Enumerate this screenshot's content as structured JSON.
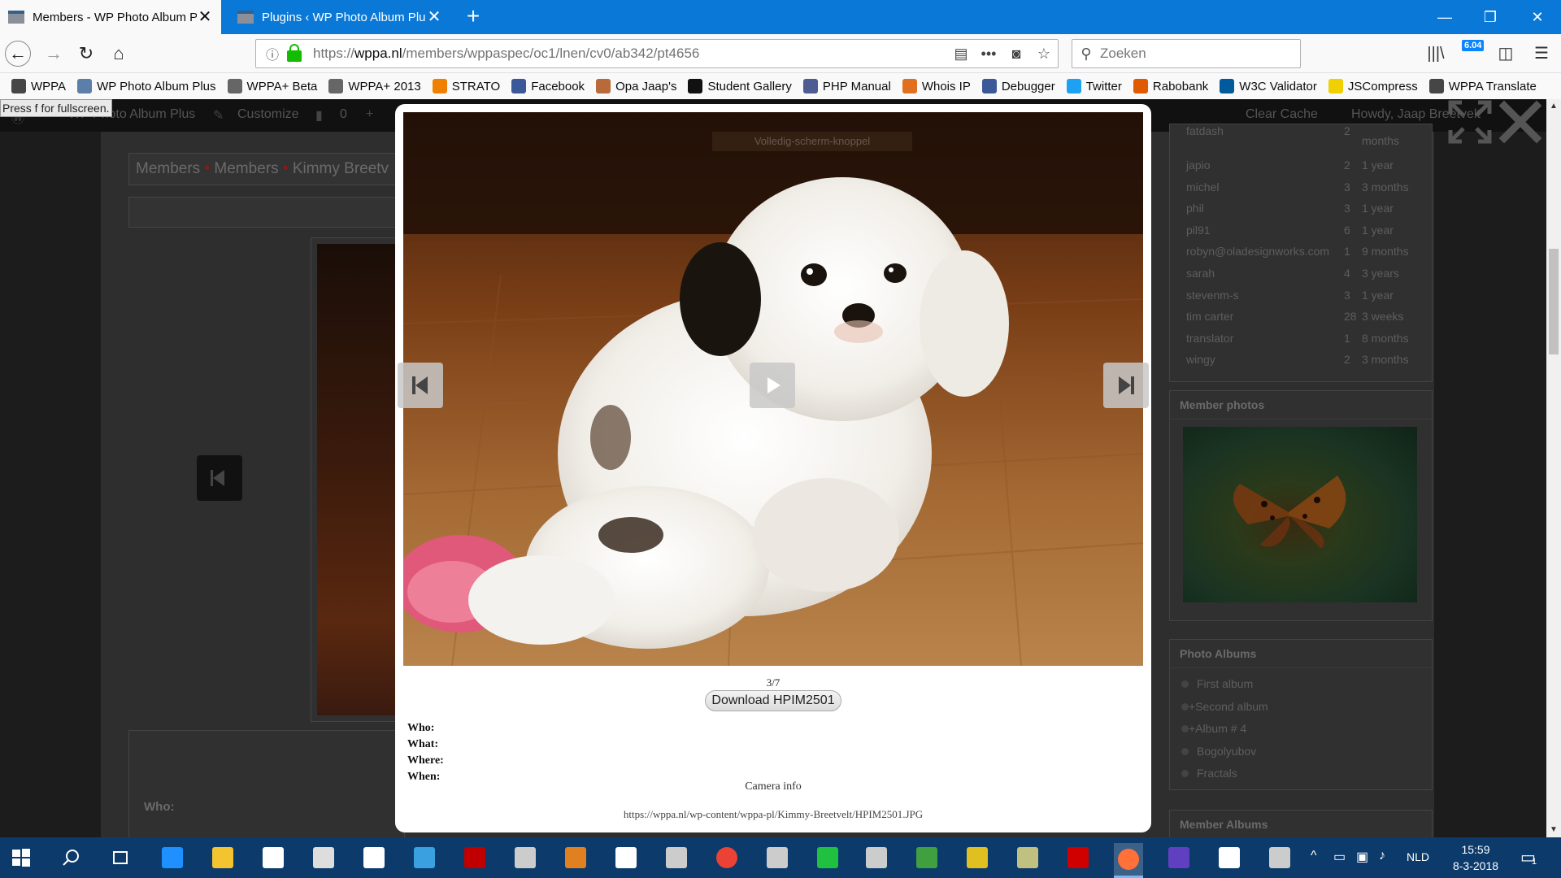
{
  "browser": {
    "tabs": [
      {
        "title": "Members - WP Photo Album Pl",
        "close": "✕",
        "active": true
      },
      {
        "title": "Plugins ‹ WP Photo Album Plus",
        "close": "✕",
        "active": false
      }
    ],
    "new_tab": "+",
    "window_controls": {
      "minimize": "—",
      "restore": "❐",
      "close": "✕"
    },
    "url": {
      "scheme": "https://",
      "domain": "wppa.nl",
      "path": "/members/wppaspec/oc1/lnen/cv0/ab342/pt4656"
    },
    "search_placeholder": "Zoeken",
    "extension_badge": "6.04",
    "bookmarks": [
      {
        "label": "WPPA",
        "icon": "wordpress-icon",
        "color": "#464646"
      },
      {
        "label": "WP Photo Album Plus",
        "icon": "wppa-icon",
        "color": "#5b7fa8"
      },
      {
        "label": "WPPA+ Beta",
        "icon": "globe-icon",
        "color": "#666666"
      },
      {
        "label": "WPPA+ 2013",
        "icon": "globe-icon",
        "color": "#666666"
      },
      {
        "label": "STRATO",
        "icon": "strato-icon",
        "color": "#f08000"
      },
      {
        "label": "Facebook",
        "icon": "facebook-icon",
        "color": "#3b5998"
      },
      {
        "label": "Opa Jaap's",
        "icon": "photo-icon",
        "color": "#b86a3a"
      },
      {
        "label": "Student Gallery",
        "icon": "gallery-icon",
        "color": "#111111"
      },
      {
        "label": "PHP Manual",
        "icon": "php-icon",
        "color": "#4f5b93"
      },
      {
        "label": "Whois IP",
        "icon": "whois-icon",
        "color": "#e07020"
      },
      {
        "label": "Debugger",
        "icon": "facebook-icon",
        "color": "#3b5998"
      },
      {
        "label": "Twitter",
        "icon": "twitter-icon",
        "color": "#1da1f2"
      },
      {
        "label": "Rabobank",
        "icon": "rabobank-icon",
        "color": "#e05a00"
      },
      {
        "label": "W3C Validator",
        "icon": "w3c-icon",
        "color": "#005a9c"
      },
      {
        "label": "JSCompress",
        "icon": "js-icon",
        "color": "#f0d000"
      },
      {
        "label": "WPPA Translate",
        "icon": "wordpress-icon",
        "color": "#464646"
      }
    ]
  },
  "page": {
    "press_f_hint": "Press f for fullscreen.",
    "wp_admin_bar": {
      "site": "WP Photo Album Plus",
      "customize": "Customize",
      "comments": "0",
      "clear_cache": "Clear Cache",
      "howdy": "Howdy, Jaap Breetvelt"
    },
    "breadcrumb": [
      "Members",
      "Members",
      "Kimmy Breetv"
    ],
    "breadcrumb_sep": "•",
    "bg_who": "Who:",
    "users": [
      {
        "name": "fatdash",
        "count": "2",
        "age": "months"
      },
      {
        "name": "japio",
        "count": "2",
        "age": "1 year"
      },
      {
        "name": "michel",
        "count": "3",
        "age": "3 months"
      },
      {
        "name": "phil",
        "count": "3",
        "age": "1 year"
      },
      {
        "name": "pil91",
        "count": "6",
        "age": "1 year"
      },
      {
        "name": "robyn@oladesignworks.com",
        "count": "1",
        "age": "9 months"
      },
      {
        "name": "sarah",
        "count": "4",
        "age": "3 years"
      },
      {
        "name": "stevenm-s",
        "count": "3",
        "age": "1 year"
      },
      {
        "name": "tim carter",
        "count": "28",
        "age": "3 weeks"
      },
      {
        "name": "translator",
        "count": "1",
        "age": "8 months"
      },
      {
        "name": "wingy",
        "count": "2",
        "age": "3 months"
      }
    ],
    "member_photos_title": "Member photos",
    "photo_albums_title": "Photo Albums",
    "albums": [
      "First album",
      "+Second album",
      "+Album # 4",
      "Bogolyubov",
      "Fractals"
    ],
    "member_albums_title": "Member Albums"
  },
  "lightbox": {
    "fullscreen_hint": "Volledig-scherm-knoppel",
    "counter": "3/7",
    "download_label": "Download HPIM2501",
    "meta": [
      {
        "label": "Who:"
      },
      {
        "label": "What:"
      },
      {
        "label": "Where:"
      },
      {
        "label": "When:"
      }
    ],
    "camera_info": "Camera info",
    "image_url": "https://wppa.nl/wp-content/wppa-pl/Kimmy-Breetvelt/HPIM2501.JPG"
  },
  "taskbar": {
    "language": "NLD",
    "time": "15:59",
    "date": "8-3-2018",
    "notifications": "1",
    "apps": [
      {
        "name": "start",
        "color": "#ffffff"
      },
      {
        "name": "search",
        "color": "#ffffff"
      },
      {
        "name": "task-view",
        "color": "#ffffff"
      },
      {
        "name": "edge",
        "color": "#1e90ff"
      },
      {
        "name": "file-explorer",
        "color": "#f4c430"
      },
      {
        "name": "store",
        "color": "#ffffff"
      },
      {
        "name": "calculator",
        "color": "#dddddd"
      },
      {
        "name": "puzzle",
        "color": "#ffffff"
      },
      {
        "name": "disc",
        "color": "#3aa0e0"
      },
      {
        "name": "mcafee",
        "color": "#c00000"
      },
      {
        "name": "remote",
        "color": "#cccccc"
      },
      {
        "name": "tool",
        "color": "#e08020"
      },
      {
        "name": "grid",
        "color": "#ffffff"
      },
      {
        "name": "image",
        "color": "#cccccc"
      },
      {
        "name": "chrome",
        "color": "#ea4335"
      },
      {
        "name": "paint",
        "color": "#cccccc"
      },
      {
        "name": "media",
        "color": "#20c040"
      },
      {
        "name": "drive",
        "color": "#cccccc"
      },
      {
        "name": "notepad",
        "color": "#40a040"
      },
      {
        "name": "maps",
        "color": "#e0c020"
      },
      {
        "name": "archive",
        "color": "#c0c080"
      },
      {
        "name": "filezilla",
        "color": "#d00000"
      },
      {
        "name": "firefox",
        "color": "#ff7139"
      },
      {
        "name": "visual-studio",
        "color": "#6040c0"
      },
      {
        "name": "cards",
        "color": "#ffffff"
      },
      {
        "name": "weather",
        "color": "#cccccc"
      }
    ]
  },
  "colors": {
    "titlebar": "#0a78d7",
    "taskbar": "#0c3a6b",
    "accent_lock": "#12bc00",
    "breadcrumb_dot": "#8a1a1a"
  }
}
